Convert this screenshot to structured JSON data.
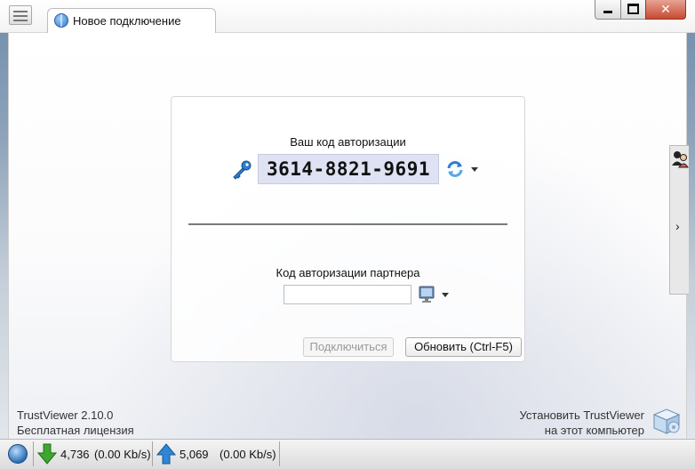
{
  "window": {
    "tab_label": "Новое подключение",
    "icons": {
      "menu": "hamburger-icon",
      "tab": "globe-icon",
      "minimize": "minimize-icon",
      "maximize": "maximize-icon",
      "close": "close-icon"
    }
  },
  "auth": {
    "your_code_label": "Ваш код авторизации",
    "code": "3614-8821-9691",
    "partner_label": "Код авторизации партнера",
    "partner_value": "",
    "connect_label": "Подключиться",
    "refresh_label": "Обновить (Ctrl-F5)",
    "icons": {
      "key": "key-icon",
      "refresh": "refresh-icon",
      "monitor": "monitor-icon",
      "dropdown": "chevron-down-icon"
    }
  },
  "side_panel": {
    "expand_glyph": "›",
    "icons": {
      "people": "people-icon",
      "expand": "chevron-right-icon"
    }
  },
  "footer": {
    "version_line1": "TrustViewer 2.10.0",
    "version_line2": "Бесплатная лицензия",
    "install_line1": "Установить TrustViewer",
    "install_line2": "на этот компьютер"
  },
  "statusbar": {
    "download_total": "4,736",
    "download_rate": "(0.00 Kb/s)",
    "upload_total": "5,069",
    "upload_rate": "(0.00 Kb/s)",
    "icons": {
      "network": "network-globe-icon",
      "download": "download-arrow-icon",
      "upload": "upload-arrow-icon"
    },
    "colors": {
      "download": "#3ca82e",
      "upload": "#2f86d6"
    }
  }
}
